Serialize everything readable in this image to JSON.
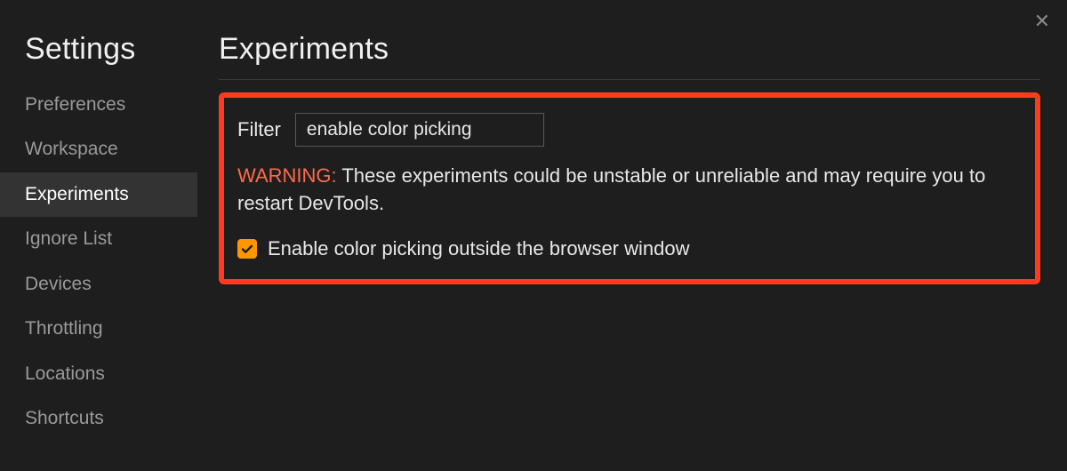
{
  "sidebar": {
    "title": "Settings",
    "items": [
      {
        "label": "Preferences",
        "active": false
      },
      {
        "label": "Workspace",
        "active": false
      },
      {
        "label": "Experiments",
        "active": true
      },
      {
        "label": "Ignore List",
        "active": false
      },
      {
        "label": "Devices",
        "active": false
      },
      {
        "label": "Throttling",
        "active": false
      },
      {
        "label": "Locations",
        "active": false
      },
      {
        "label": "Shortcuts",
        "active": false
      }
    ]
  },
  "main": {
    "title": "Experiments",
    "filter_label": "Filter",
    "filter_value": "enable color picking",
    "warning_prefix": "WARNING:",
    "warning_body": " These experiments could be unstable or unreliable and may require you to restart DevTools.",
    "experiment": {
      "checked": true,
      "label": "Enable color picking outside the browser window"
    }
  },
  "colors": {
    "accent_orange": "#ff9500",
    "highlight_red": "#ff3b1f",
    "warning_text": "#ff6a4d"
  }
}
